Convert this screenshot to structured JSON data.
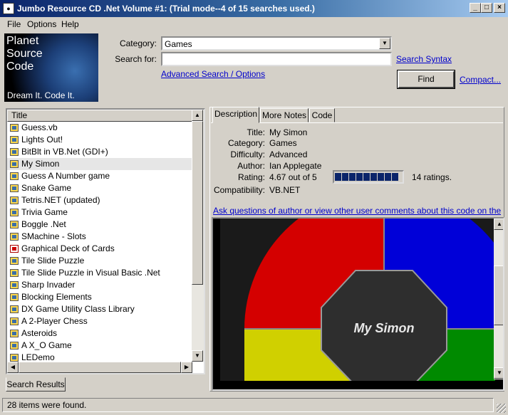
{
  "window": {
    "title": "Jumbo Resource CD .Net Volume #1: (Trial mode--4 of 15 searches used.)",
    "minimize": "_",
    "maximize": "□",
    "close": "×"
  },
  "menu": [
    {
      "label": "File"
    },
    {
      "label": "Options"
    },
    {
      "label": "Help"
    }
  ],
  "logo": {
    "lines": [
      "Planet",
      "Source",
      "Code"
    ],
    "tagline": "Dream It.  Code It."
  },
  "search": {
    "category_label": "Category:",
    "category_value": "Games",
    "searchfor_label": "Search for:",
    "searchfor_value": "",
    "syntax_link": "Search Syntax",
    "advanced_link": "Advanced Search / Options",
    "find_button": "Find",
    "compact_link": "Compact..."
  },
  "results": {
    "column_header": "Title",
    "selected_index": 3,
    "items": [
      {
        "label": "Guess.vb"
      },
      {
        "label": "Lights Out!"
      },
      {
        "label": "BitBlt in VB.Net (GDI+)"
      },
      {
        "label": "My Simon"
      },
      {
        "label": "Guess A Number game"
      },
      {
        "label": "Snake Game"
      },
      {
        "label": "Tetris.NET (updated)"
      },
      {
        "label": "Trivia Game"
      },
      {
        "label": "Boggle .Net"
      },
      {
        "label": "SMachine - Slots"
      },
      {
        "label": "Graphical Deck of Cards",
        "icon": "cards"
      },
      {
        "label": "Tile Slide Puzzle"
      },
      {
        "label": "Tile Slide Puzzle in Visual Basic .Net"
      },
      {
        "label": "Sharp Invader"
      },
      {
        "label": "Blocking Elements"
      },
      {
        "label": "DX Game Utility Class Library"
      },
      {
        "label": "A 2-Player Chess"
      },
      {
        "label": "Asteroids"
      },
      {
        "label": "A X_O Game"
      },
      {
        "label": "LEDemo"
      }
    ],
    "bottom_tab": "Search Results"
  },
  "detail": {
    "tabs": [
      {
        "label": "Description"
      },
      {
        "label": "More Notes"
      },
      {
        "label": "Code"
      }
    ],
    "fields": {
      "title_label": "Title:",
      "title_value": "My Simon",
      "category_label": "Category:",
      "category_value": "Games",
      "difficulty_label": "Difficulty:",
      "difficulty_value": "Advanced",
      "author_label": "Author:",
      "author_value": "Ian Applegate",
      "rating_label": "Rating:",
      "rating_value": "4.67 out of 5",
      "compat_label": "Compatibility:",
      "compat_value": "VB.NET"
    },
    "rating_level": 0.934,
    "ratings_count": "14 ratings.",
    "ask_link": "Ask questions of author or view other user comments about this code on the web...",
    "screenshot_caption": "My Simon",
    "colors": {
      "red": "#d40000",
      "blue": "#0000d8",
      "yellow": "#d0d000",
      "green": "#008a00",
      "center": "#2e2e2e"
    }
  },
  "status": {
    "text": "28 items were found."
  }
}
